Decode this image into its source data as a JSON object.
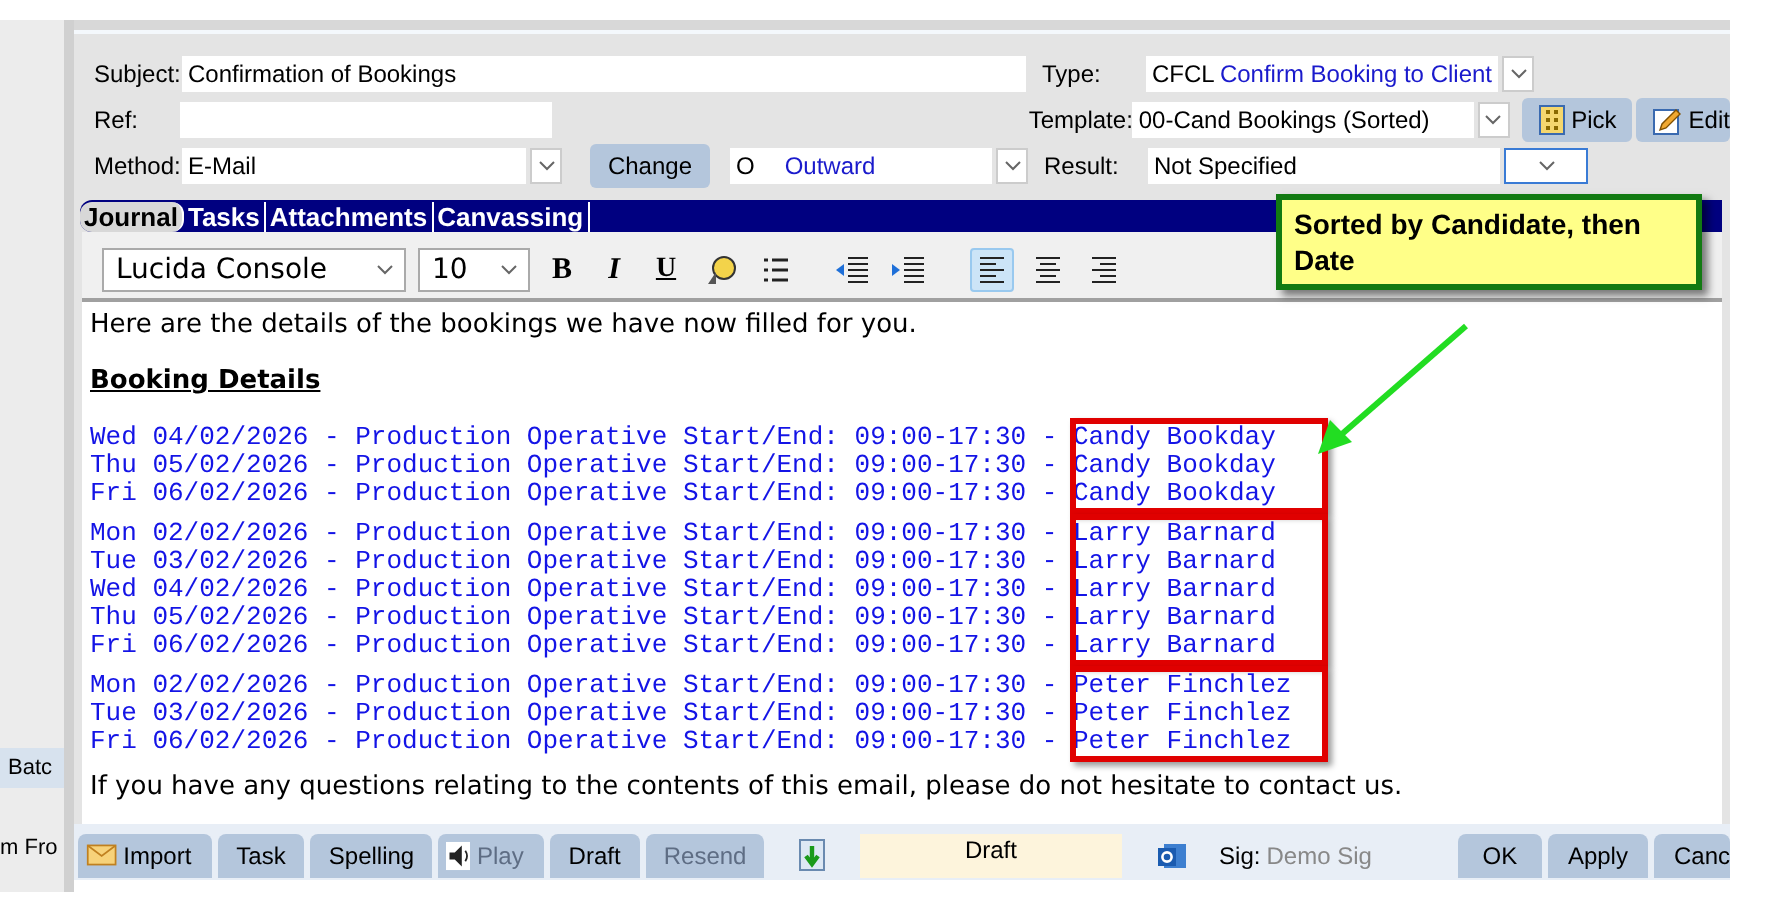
{
  "background_window": {
    "texts": [
      "Batc",
      "m Fro"
    ]
  },
  "form": {
    "subject": {
      "label": "Subject:",
      "value": "Confirmation of Bookings"
    },
    "ref": {
      "label": "Ref:"
    },
    "method": {
      "label": "Method:",
      "value": "E-Mail"
    },
    "change_button": "Change",
    "direction": {
      "code": "O",
      "name": "Outward"
    },
    "type": {
      "label": "Type:",
      "code": "CFCL",
      "name": "Confirm Booking to Client"
    },
    "template": {
      "label": "Template:",
      "value": "00-Cand Bookings (Sorted)"
    },
    "pick_button": "Pick",
    "edit_button": "Edit",
    "result": {
      "label": "Result:",
      "value": "Not Specified"
    }
  },
  "tabs": [
    {
      "label": "Journal",
      "selected": true
    },
    {
      "label": "Tasks",
      "selected": false
    },
    {
      "label": "Attachments",
      "selected": false
    },
    {
      "label": "Canvassing",
      "selected": false
    }
  ],
  "toolbar": {
    "font": "Lucida Console",
    "size": "10",
    "format": [
      {
        "kind": "bold",
        "label": "B"
      },
      {
        "kind": "italic",
        "label": "I"
      },
      {
        "kind": "underline",
        "label": "U"
      }
    ],
    "align": [
      {
        "kind": "left",
        "selected": true
      },
      {
        "kind": "center",
        "selected": false
      },
      {
        "kind": "right",
        "selected": false
      }
    ]
  },
  "body": {
    "intro": "Here are the details of the bookings we have now filled for you.",
    "heading": "Booking Details",
    "groups": [
      {
        "lines": [
          "Wed 04/02/2026 - Production Operative Start/End: 09:00-17:30 - Candy Bookday",
          "Thu 05/02/2026 - Production Operative Start/End: 09:00-17:30 - Candy Bookday",
          "Fri 06/02/2026 - Production Operative Start/End: 09:00-17:30 - Candy Bookday"
        ]
      },
      {
        "lines": [
          "Mon 02/02/2026 - Production Operative Start/End: 09:00-17:30 - Larry Barnard",
          "Tue 03/02/2026 - Production Operative Start/End: 09:00-17:30 - Larry Barnard",
          "Wed 04/02/2026 - Production Operative Start/End: 09:00-17:30 - Larry Barnard",
          "Thu 05/02/2026 - Production Operative Start/End: 09:00-17:30 - Larry Barnard",
          "Fri 06/02/2026 - Production Operative Start/End: 09:00-17:30 - Larry Barnard"
        ]
      },
      {
        "lines": [
          "Mon 02/02/2026 - Production Operative Start/End: 09:00-17:30 - Peter Finchlez",
          "Tue 03/02/2026 - Production Operative Start/End: 09:00-17:30 - Peter Finchlez",
          "Fri 06/02/2026 - Production Operative Start/End: 09:00-17:30 - Peter Finchlez"
        ]
      }
    ],
    "closing": "If you have any questions relating to the contents of this email, please do not hesitate to contact us."
  },
  "callout": {
    "text": "Sorted by Candidate, then Date"
  },
  "footer": {
    "buttons": [
      {
        "label": "Import",
        "kind": "import",
        "disabled": false
      },
      {
        "label": "Task",
        "kind": "plain",
        "disabled": false
      },
      {
        "label": "Spelling",
        "kind": "plain",
        "disabled": false
      },
      {
        "label": "Play",
        "kind": "sound",
        "disabled": true
      },
      {
        "label": "Draft",
        "kind": "plain",
        "disabled": false
      },
      {
        "label": "Resend",
        "kind": "plain",
        "disabled": true
      }
    ],
    "status": "Draft",
    "signature": {
      "label": "Sig:",
      "value": "Demo Sig"
    },
    "actions": [
      "OK",
      "Apply",
      "Canc"
    ]
  }
}
